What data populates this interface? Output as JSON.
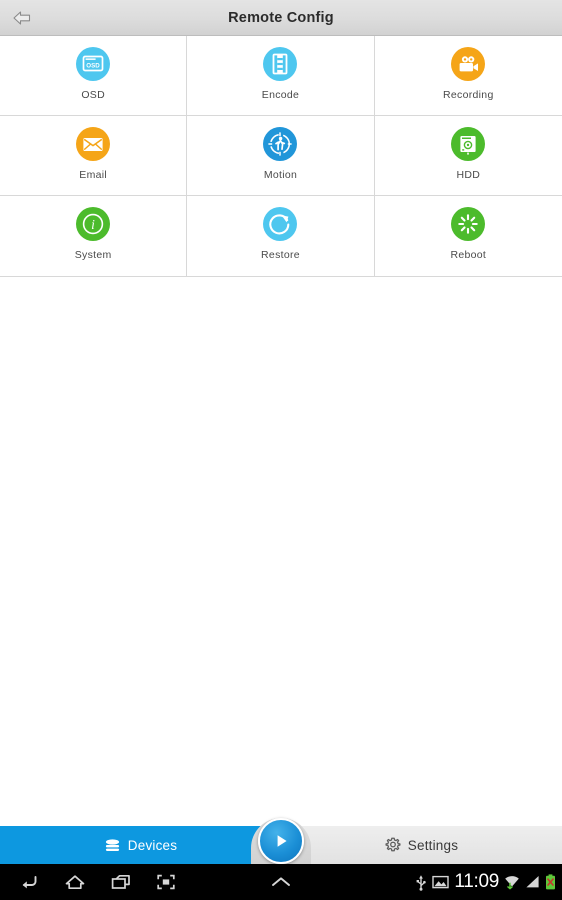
{
  "header": {
    "title": "Remote Config",
    "back_icon": "back-arrow-icon"
  },
  "grid": {
    "items": [
      {
        "label": "OSD",
        "icon": "osd-monitor-icon",
        "color": "#4ec7ef",
        "badge_text": "OSD"
      },
      {
        "label": "Encode",
        "icon": "film-strip-icon",
        "color": "#4ec7ef"
      },
      {
        "label": "Recording",
        "icon": "video-camera-icon",
        "color": "#f5a518"
      },
      {
        "label": "Email",
        "icon": "envelope-icon",
        "color": "#f5a518"
      },
      {
        "label": "Motion",
        "icon": "motion-person-icon",
        "color": "#2196d9"
      },
      {
        "label": "HDD",
        "icon": "hard-disk-icon",
        "color": "#4cbb2c"
      },
      {
        "label": "System",
        "icon": "info-circle-icon",
        "color": "#4cbb2c"
      },
      {
        "label": "Restore",
        "icon": "refresh-arrow-icon",
        "color": "#4ec7ef"
      },
      {
        "label": "Reboot",
        "icon": "spinner-burst-icon",
        "color": "#4cbb2c"
      }
    ]
  },
  "tabbar": {
    "devices_label": "Devices",
    "devices_icon": "devices-stack-icon",
    "settings_label": "Settings",
    "settings_icon": "gear-icon",
    "play_icon": "play-icon",
    "active_tab": "Devices",
    "active_color": "#0d98e0"
  },
  "system_bar": {
    "back_icon": "android-back-icon",
    "home_icon": "android-home-icon",
    "recents_icon": "android-recents-icon",
    "screenshot_icon": "android-screenshot-icon",
    "expand_icon": "android-expand-up-icon",
    "usb_icon": "usb-icon",
    "screenshot_notif_icon": "image-notification-icon",
    "clock": "11:09",
    "wifi_icon": "wifi-icon",
    "signal_icon": "cellular-signal-icon",
    "battery_icon": "battery-error-icon"
  }
}
